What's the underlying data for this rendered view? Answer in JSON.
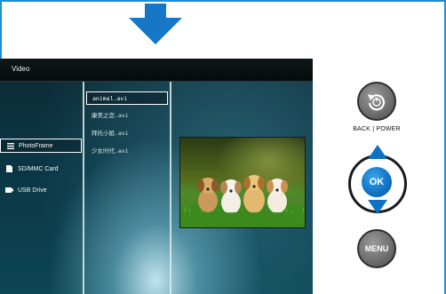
{
  "screen": {
    "title": "Video",
    "sources": [
      {
        "label": "PhotoFrame",
        "icon": "list-icon",
        "selected": true
      },
      {
        "label": "SD/MMC Card",
        "icon": "sd-card-icon",
        "selected": false
      },
      {
        "label": "USB Drive",
        "icon": "usb-drive-icon",
        "selected": false
      }
    ],
    "files": [
      {
        "label": "animal.avi",
        "selected": true
      },
      {
        "label": "康美之恋.avi",
        "selected": false
      },
      {
        "label": "拜托小姐.avi",
        "selected": false
      },
      {
        "label": "少女时代.avi",
        "selected": false
      }
    ],
    "preview_icon": "puppies-thumbnail"
  },
  "controls": {
    "back_power_label": "BACK | POWER",
    "ok_label": "OK",
    "menu_label": "MENU"
  },
  "colors": {
    "arrow": "#1777c7",
    "ok_button": "#0e72c4",
    "frame_border": "#1a8fd6"
  }
}
